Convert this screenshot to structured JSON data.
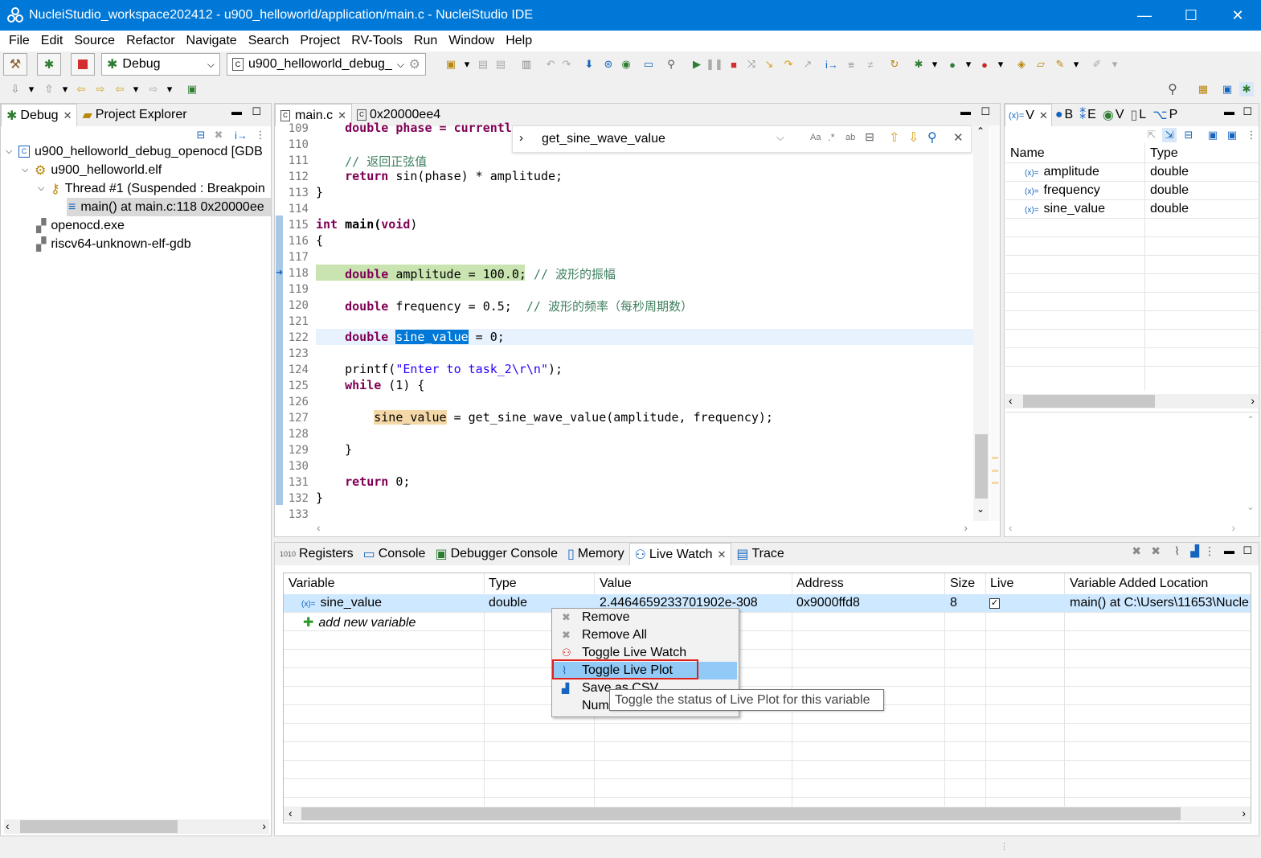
{
  "window": {
    "title": "NucleiStudio_workspace202412 - u900_helloworld/application/main.c - NucleiStudio IDE",
    "minimize": "—",
    "maximize": "☐",
    "close": "✕"
  },
  "menu": [
    "File",
    "Edit",
    "Source",
    "Refactor",
    "Navigate",
    "Search",
    "Project",
    "RV-Tools",
    "Run",
    "Window",
    "Help"
  ],
  "toolbar": {
    "launch_mode": "Debug",
    "launch_config": "u900_helloworld_debug_"
  },
  "debug_view": {
    "tabs": [
      {
        "label": "Debug",
        "active": true
      },
      {
        "label": "Project Explorer",
        "active": false
      }
    ],
    "tree": [
      {
        "label": "u900_helloworld_debug_openocd [GDB",
        "level": 0
      },
      {
        "label": "u900_helloworld.elf",
        "level": 1
      },
      {
        "label": "Thread #1 (Suspended : Breakpoin",
        "level": 2
      },
      {
        "label": "main() at main.c:118 0x20000ee",
        "level": 3,
        "selected": true
      },
      {
        "label": "openocd.exe",
        "level": 1
      },
      {
        "label": "riscv64-unknown-elf-gdb",
        "level": 1
      }
    ]
  },
  "editor": {
    "tabs": [
      {
        "label": "main.c",
        "active": true
      },
      {
        "label": "0x20000ee4",
        "active": false
      }
    ],
    "find": {
      "value": "get_sine_wave_value"
    },
    "line_numbers": [
      "109",
      "110",
      "111",
      "112",
      "113",
      "114",
      "115",
      "116",
      "117",
      "118",
      "119",
      "120",
      "121",
      "122",
      "123",
      "124",
      "125",
      "126",
      "127",
      "128",
      "129",
      "130",
      "131",
      "132",
      "133"
    ],
    "lines": {
      "l109": "    double phase = currentl",
      "l111": "    // 返回正弦值",
      "l112_a": "    return ",
      "l112_b": "sin(phase) * amplitude;",
      "l113": "}",
      "l115_a": "int",
      "l115_b": " main(",
      "l115_c": "void",
      "l115_d": ")",
      "l116": "{",
      "l118_a": "    double",
      "l118_b": " amplitude = 100.0; ",
      "l118_c": "// 波形的振幅",
      "l120_a": "    double",
      "l120_b": " frequency = 0.5;  ",
      "l120_c": "// 波形的频率（每秒周期数）",
      "l122_a": "    double ",
      "l122_b": "sine_value",
      "l122_c": " = 0;",
      "l124_a": "    printf(",
      "l124_b": "\"Enter to task_2\\r\\n\"",
      "l124_c": ");",
      "l125_a": "    while",
      "l125_b": " (1) {",
      "l127_a": "        ",
      "l127_b": "sine_value",
      "l127_c": " = get_sine_wave_value(amplitude, frequency);",
      "l129": "    }",
      "l131_a": "    return",
      "l131_b": " 0;",
      "l132": "}"
    }
  },
  "variables_view": {
    "tabs": [
      "V",
      "B",
      "E",
      "V",
      "L",
      "P"
    ],
    "columns": [
      "Name",
      "Type"
    ],
    "rows": [
      {
        "name": "amplitude",
        "type": "double"
      },
      {
        "name": "frequency",
        "type": "double"
      },
      {
        "name": "sine_value",
        "type": "double"
      }
    ]
  },
  "bottom_view": {
    "tabs": [
      {
        "label": "Registers",
        "active": false
      },
      {
        "label": "Console",
        "active": false
      },
      {
        "label": "Debugger Console",
        "active": false
      },
      {
        "label": "Memory",
        "active": false
      },
      {
        "label": "Live Watch",
        "active": true
      },
      {
        "label": "Trace",
        "active": false
      }
    ],
    "columns": [
      "Variable",
      "Type",
      "Value",
      "Address",
      "Size",
      "Live",
      "Variable Added Location"
    ],
    "row": {
      "variable": "sine_value",
      "type": "double",
      "value": "2.4464659233701902e-308",
      "address": "0x9000ffd8",
      "size": "8",
      "live": true,
      "location": "main() at C:\\Users\\11653\\Nucle"
    },
    "add_new": "add new variable"
  },
  "context_menu": {
    "items": [
      "Remove",
      "Remove All",
      "Toggle Live Watch",
      "Toggle Live Plot",
      "Save as CSV",
      "Number Format"
    ],
    "highlighted": "Toggle Live Plot",
    "tooltip": "Toggle the status of Live Plot for this variable"
  },
  "colors": {
    "titlebar": "#0078d7",
    "highlight_line": "#c9e4b0",
    "selection": "#0078d7",
    "menu_highlight": "#91c9f7",
    "red_outline": "#e0201b"
  }
}
